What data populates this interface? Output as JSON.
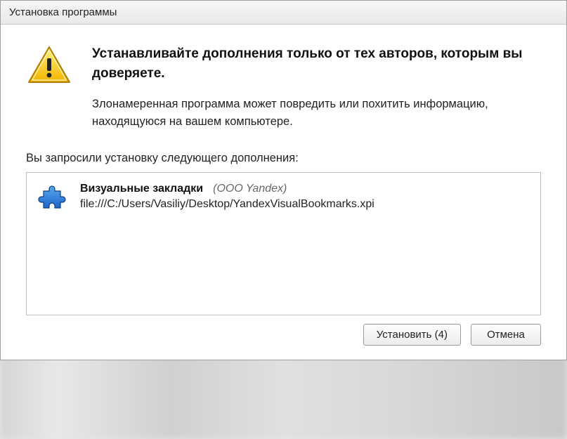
{
  "window": {
    "title": "Установка программы"
  },
  "warning": {
    "heading": "Устанавливайте дополнения только от тех авторов, которым вы доверяете.",
    "description": "Злонамеренная программа может повредить или похитить информацию, находящуюся на вашем компьютере."
  },
  "request": {
    "label": "Вы запросили установку следующего дополнения:"
  },
  "addon": {
    "name": "Визуальные закладки",
    "publisher": "(OOO Yandex)",
    "path": "file:///C:/Users/Vasiliy/Desktop/YandexVisualBookmarks.xpi"
  },
  "buttons": {
    "install": "Установить (4)",
    "cancel": "Отмена"
  },
  "icons": {
    "warning": "warning-triangle",
    "addon": "puzzle-piece"
  }
}
